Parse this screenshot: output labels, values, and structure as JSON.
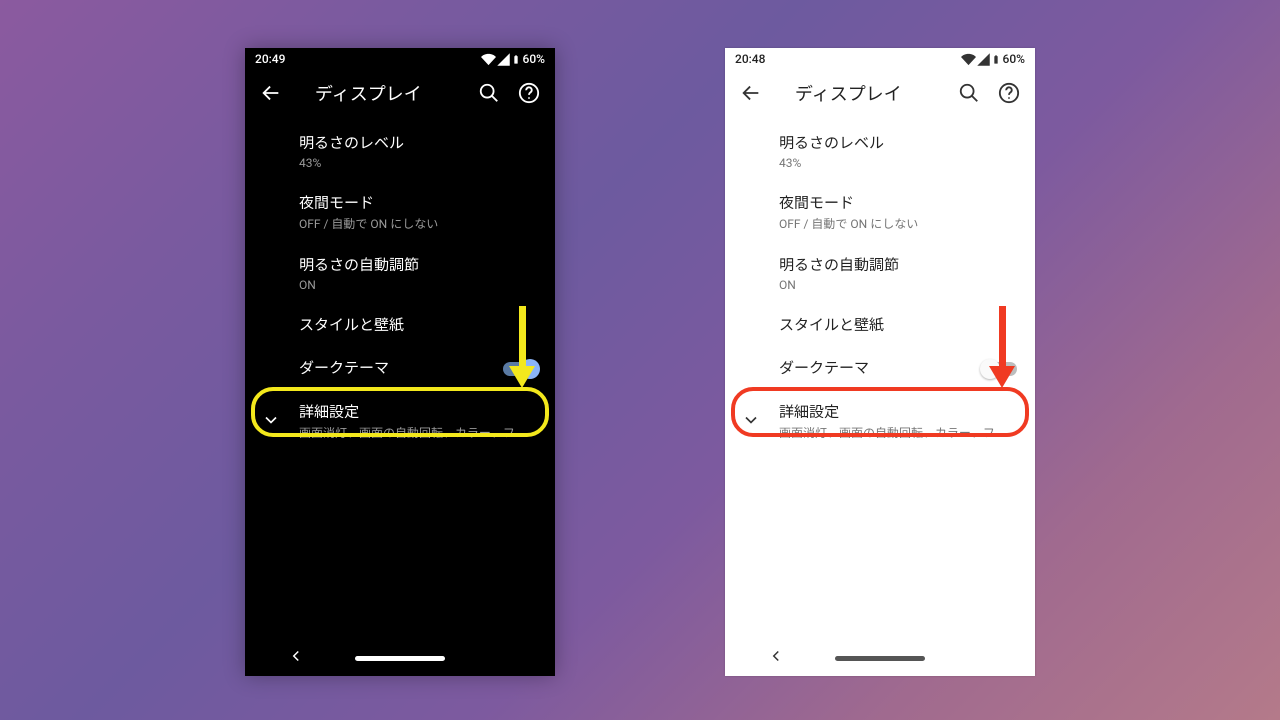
{
  "annotation_colors": {
    "yellow": "#f3e81c",
    "red": "#f03a22"
  },
  "dark": {
    "status": {
      "time": "20:49",
      "battery": "60%"
    },
    "title": "ディスプレイ",
    "brightness": {
      "label": "明るさのレベル",
      "value": "43%"
    },
    "night": {
      "label": "夜間モード",
      "value": "OFF / 自動で ON にしない"
    },
    "adaptive": {
      "label": "明るさの自動調節",
      "value": "ON"
    },
    "style": {
      "label": "スタイルと壁紙"
    },
    "darktheme": {
      "label": "ダークテーマ",
      "on": true
    },
    "advanced": {
      "label": "詳細設定",
      "value": "画面消灯、画面の自動回転、カラー、フ..."
    },
    "highlight": "yellow"
  },
  "light": {
    "status": {
      "time": "20:48",
      "battery": "60%"
    },
    "title": "ディスプレイ",
    "brightness": {
      "label": "明るさのレベル",
      "value": "43%"
    },
    "night": {
      "label": "夜間モード",
      "value": "OFF / 自動で ON にしない"
    },
    "adaptive": {
      "label": "明るさの自動調節",
      "value": "ON"
    },
    "style": {
      "label": "スタイルと壁紙"
    },
    "darktheme": {
      "label": "ダークテーマ",
      "on": false
    },
    "advanced": {
      "label": "詳細設定",
      "value": "画面消灯、画面の自動回転、カラー、フ..."
    },
    "highlight": "red"
  }
}
